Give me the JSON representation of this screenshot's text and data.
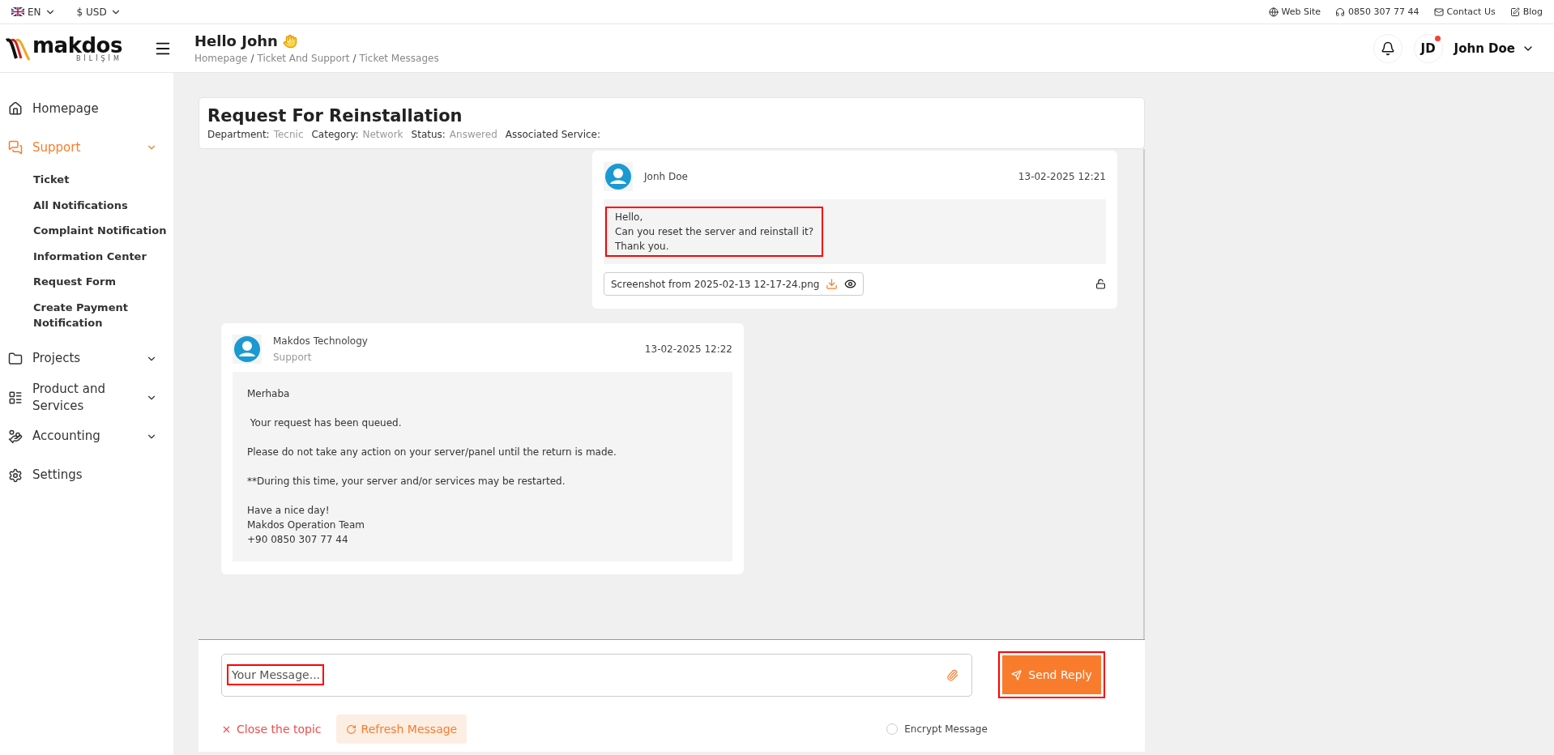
{
  "top_bar": {
    "language": "EN",
    "currency": "$ USD",
    "links": [
      {
        "label": "Web Site"
      },
      {
        "label": "0850 307 77 44"
      },
      {
        "label": "Contact Us"
      },
      {
        "label": "Blog"
      }
    ]
  },
  "logo": {
    "name": "makdos",
    "tagline": "BİLİŞİM"
  },
  "header": {
    "greeting": "Hello John",
    "breadcrumbs": [
      "Homepage",
      "Ticket And Support",
      "Ticket Messages"
    ],
    "separator": "/",
    "user": {
      "initials": "JD",
      "name": "John Doe",
      "has_notification": true
    }
  },
  "sidebar": {
    "items": [
      {
        "label": "Homepage",
        "selected": false
      },
      {
        "label": "Support",
        "selected": true,
        "expanded": true,
        "children": [
          {
            "label": "Ticket"
          },
          {
            "label": "All Notifications"
          },
          {
            "label": "Complaint Notification"
          },
          {
            "label": "Information Center"
          },
          {
            "label": "Request Form"
          },
          {
            "label": "Create Payment Notification"
          }
        ]
      },
      {
        "label": "Projects",
        "selected": false,
        "expandable": true
      },
      {
        "label": "Product and Services",
        "selected": false,
        "expandable": true
      },
      {
        "label": "Accounting",
        "selected": false,
        "expandable": true
      },
      {
        "label": "Settings",
        "selected": false
      }
    ]
  },
  "ticket": {
    "title": "Request For Reinstallation",
    "meta": [
      {
        "label": "Department:",
        "value": "Tecnic"
      },
      {
        "label": "Category:",
        "value": "Network"
      },
      {
        "label": "Status:",
        "value": "Answered"
      },
      {
        "label": "Associated Service:"
      }
    ]
  },
  "messages": [
    {
      "kind": "user",
      "author": "Jonh Doe",
      "time": "13-02-2025 12:21",
      "text": "Hello,\nCan you reset the server and reinstall it?\nThank you.",
      "highlighted": true,
      "attachment": "Screenshot from 2025-02-13 12-17-24.png"
    },
    {
      "kind": "staff",
      "author": "Makdos Technology",
      "role": "Support",
      "time": "13-02-2025 12:22",
      "text": "Merhaba\n\n Your request has been queued.\n\nPlease do not take any action on your server/panel until the return is made.\n\n**During this time, your server and/or services may be restarted.\n\nHave a nice day!\nMakdos Operation Team\n+90 0850 307 77 44",
      "highlighted": false
    }
  ],
  "reply": {
    "placeholder": "Your Message...",
    "placeholder_highlighted": true,
    "send_label": "Send Reply",
    "send_highlighted": true,
    "close_label": "Close the topic",
    "refresh_label": "Refresh Message",
    "encrypt": {
      "label": "Encrypt Message",
      "checked": false
    }
  }
}
